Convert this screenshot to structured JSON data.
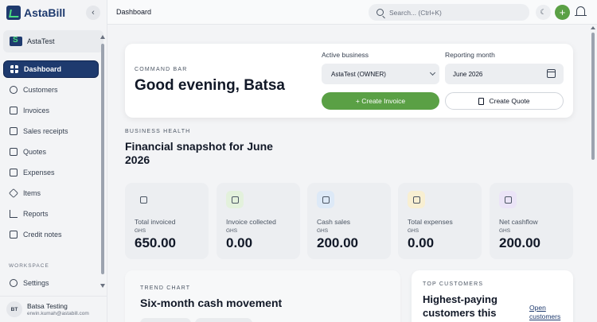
{
  "app": {
    "name": "AstaBill"
  },
  "sidebar": {
    "business": "AstaTest",
    "items": [
      {
        "label": "Dashboard",
        "icon": "dashboard-icon",
        "active": true
      },
      {
        "label": "Customers",
        "icon": "users-icon"
      },
      {
        "label": "Invoices",
        "icon": "invoice-icon"
      },
      {
        "label": "Sales receipts",
        "icon": "receipt-icon"
      },
      {
        "label": "Quotes",
        "icon": "quote-icon"
      },
      {
        "label": "Expenses",
        "icon": "wallet-icon"
      },
      {
        "label": "Items",
        "icon": "box-icon"
      },
      {
        "label": "Reports",
        "icon": "bar-chart-icon"
      },
      {
        "label": "Credit notes",
        "icon": "credit-note-icon"
      }
    ],
    "workspace_label": "WORKSPACE",
    "settings_label": "Settings",
    "user": {
      "initials": "BT",
      "name": "Batsa Testing",
      "email": "erwin.kumah@astabill.com"
    }
  },
  "header": {
    "breadcrumb": "Dashboard",
    "search_placeholder": "Search... (Ctrl+K)"
  },
  "command_bar": {
    "label": "COMMAND BAR",
    "greeting": "Good evening, Batsa",
    "active_business_label": "Active business",
    "active_business_value": "AstaTest (OWNER)",
    "reporting_month_label": "Reporting month",
    "reporting_month_value": "June 2026",
    "create_invoice_label": "+  Create Invoice",
    "create_quote_label": "Create Quote"
  },
  "business_health": {
    "label": "BUSINESS HEALTH",
    "title": "Financial snapshot for June 2026",
    "kpis": [
      {
        "label": "Total invoiced",
        "currency": "GHS",
        "value": "650.00",
        "icon": "bank-icon",
        "tint": "#eceef1"
      },
      {
        "label": "Invoice collected",
        "currency": "GHS",
        "value": "0.00",
        "icon": "wallet-icon",
        "tint": "#e3f1dc"
      },
      {
        "label": "Cash sales",
        "currency": "GHS",
        "value": "200.00",
        "icon": "shopping-bag-icon",
        "tint": "#dde9f7"
      },
      {
        "label": "Total expenses",
        "currency": "GHS",
        "value": "0.00",
        "icon": "document-icon",
        "tint": "#f8efd2"
      },
      {
        "label": "Net cashflow",
        "currency": "GHS",
        "value": "200.00",
        "icon": "trend-up-icon",
        "tint": "#ebe4f7"
      }
    ]
  },
  "trend": {
    "label": "TREND CHART",
    "title": "Six-month cash movement"
  },
  "top_customers": {
    "label": "TOP CUSTOMERS",
    "title": "Highest-paying customers this period",
    "link": "Open customers"
  },
  "colors": {
    "brand": "#1e3a6e",
    "accent_green": "#5aa045"
  }
}
